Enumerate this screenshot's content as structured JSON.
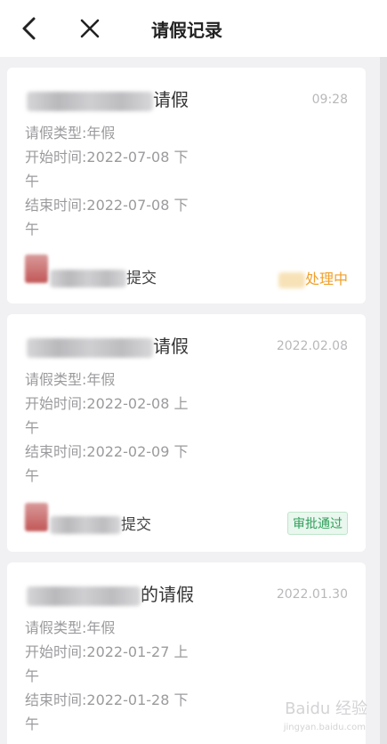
{
  "header": {
    "title": "请假记录",
    "back_icon": "chevron-left-icon",
    "close_icon": "close-icon"
  },
  "records": [
    {
      "title_suffix": "请假",
      "time": "09:28",
      "type": "请假类型:年假",
      "start_line1": "开始时间:2022-07-08 下",
      "start_line2": "午",
      "end_line1": "结束时间:2022-07-08 下",
      "end_line2": "午",
      "submit_text": "提交",
      "status": "处理中",
      "status_color": "#f0a02a"
    },
    {
      "title_suffix": "请假",
      "time": "2022.02.08",
      "type": "请假类型:年假",
      "start_line1": "开始时间:2022-02-08 上",
      "start_line2": "午",
      "end_line1": "结束时间:2022-02-09 下",
      "end_line2": "午",
      "submit_text": "提交",
      "status": "审批通过",
      "status_color": "#2fa05a"
    },
    {
      "title_suffix": "的请假",
      "time": "2022.01.30",
      "type": "请假类型:年假",
      "start_line1": "开始时间:2022-01-27 上",
      "start_line2": "午",
      "end_line1": "结束时间:2022-01-28 下",
      "end_line2": "午"
    }
  ],
  "watermark": {
    "logo_text": "Baidu 经验",
    "sub_text": "jingyan.baidu.com"
  }
}
